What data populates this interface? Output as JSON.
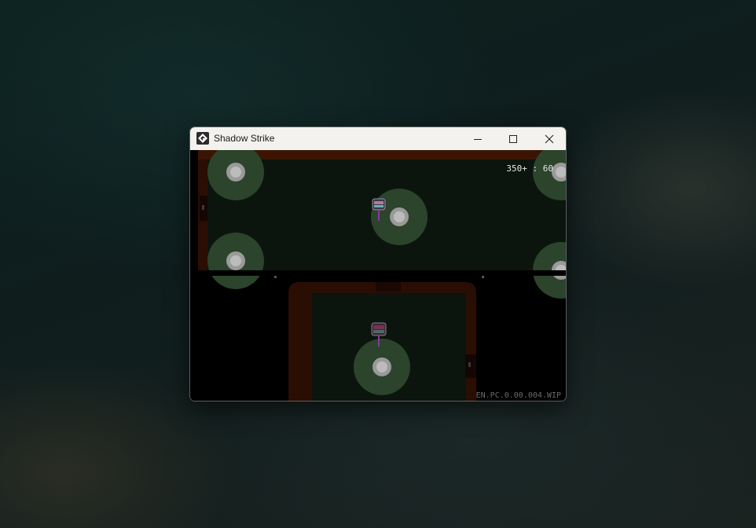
{
  "window": {
    "title": "Shadow Strike",
    "app_icon": "gamemaker-logo-icon"
  },
  "controls": {
    "minimize_icon": "minimize-icon",
    "maximize_icon": "maximize-icon",
    "close_icon": "close-icon"
  },
  "hud": {
    "score_text": "350+ : 60",
    "version_text": "EN.PC.0.00.004.WIP"
  },
  "colors": {
    "floor": "#0b150d",
    "wall": "#2a0e03",
    "wall_accent": "#5a1e05",
    "light_pool": "#2b442b",
    "light_core": "#9a9a9a",
    "titlebar": "#f3f2ee"
  }
}
